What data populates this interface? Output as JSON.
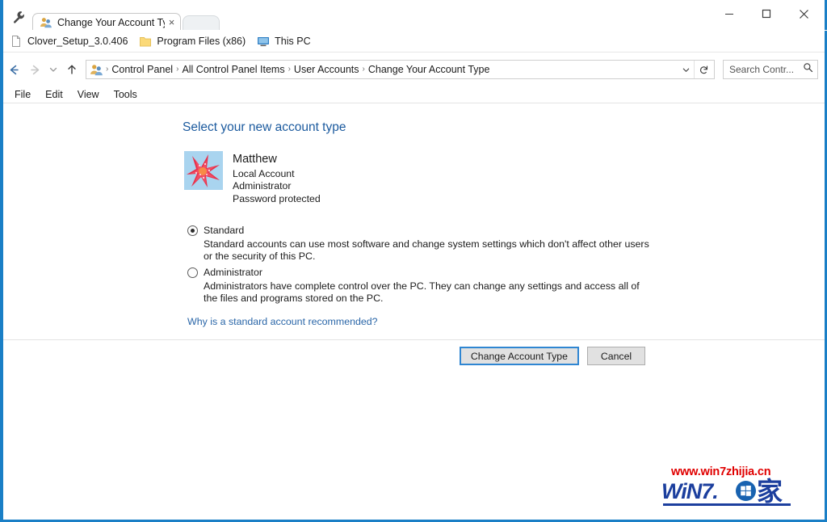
{
  "window": {
    "title": "Change Your Account Type",
    "controls": {
      "minimize": "minimize-button",
      "maximize": "maximize-button",
      "close": "close-button"
    }
  },
  "tabbar": {
    "wrench_icon": "wrench-icon",
    "tab_title": "Change Your Account Typ",
    "tab_favicon": "user-accounts-icon",
    "close_glyph": "×",
    "new_tab": "new-tab-button"
  },
  "bookmarks": [
    {
      "label": "Clover_Setup_3.0.406",
      "icon": "document-icon"
    },
    {
      "label": "Program Files (x86)",
      "icon": "folder-icon"
    },
    {
      "label": "This PC",
      "icon": "monitor-icon"
    }
  ],
  "navigation": {
    "back": "←",
    "forward": "→",
    "recent": "⌄",
    "up": "↑"
  },
  "address": {
    "icon": "user-accounts-icon",
    "separator": "›",
    "crumbs": [
      "Control Panel",
      "All Control Panel Items",
      "User Accounts",
      "Change Your Account Type"
    ],
    "dropdown_glyph": "⌄",
    "refresh_glyph": "↻"
  },
  "search": {
    "placeholder": "Search Contr...",
    "icon": "search-icon"
  },
  "menubar": {
    "items": [
      "File",
      "Edit",
      "View",
      "Tools"
    ]
  },
  "main": {
    "heading": "Select your new account type",
    "account": {
      "avatar": "starfish-avatar",
      "name": "Matthew",
      "lines": [
        "Local Account",
        "Administrator",
        "Password protected"
      ]
    },
    "options": [
      {
        "label": "Standard",
        "selected": true,
        "description": "Standard accounts can use most software and change system settings which don't affect other users or the security of this PC."
      },
      {
        "label": "Administrator",
        "selected": false,
        "description": "Administrators have complete control over the PC. They can change any settings and access all of the files and programs stored on the PC."
      }
    ],
    "help_link": "Why is a standard account recommended?",
    "buttons": {
      "primary": "Change Account Type",
      "secondary": "Cancel"
    }
  },
  "watermark": {
    "url": "www.win7zhijia.cn",
    "logo_text": "WiN7.",
    "logo_cjk": "家",
    "flag_icon": "windows-flag-icon"
  },
  "colors": {
    "window_border": "#1a7fc6",
    "heading": "#1b5a9e",
    "link": "#2a66a8",
    "focus_ring": "#2f86d2",
    "watermark_red": "#e00000",
    "watermark_blue": "#1c3f9e"
  }
}
